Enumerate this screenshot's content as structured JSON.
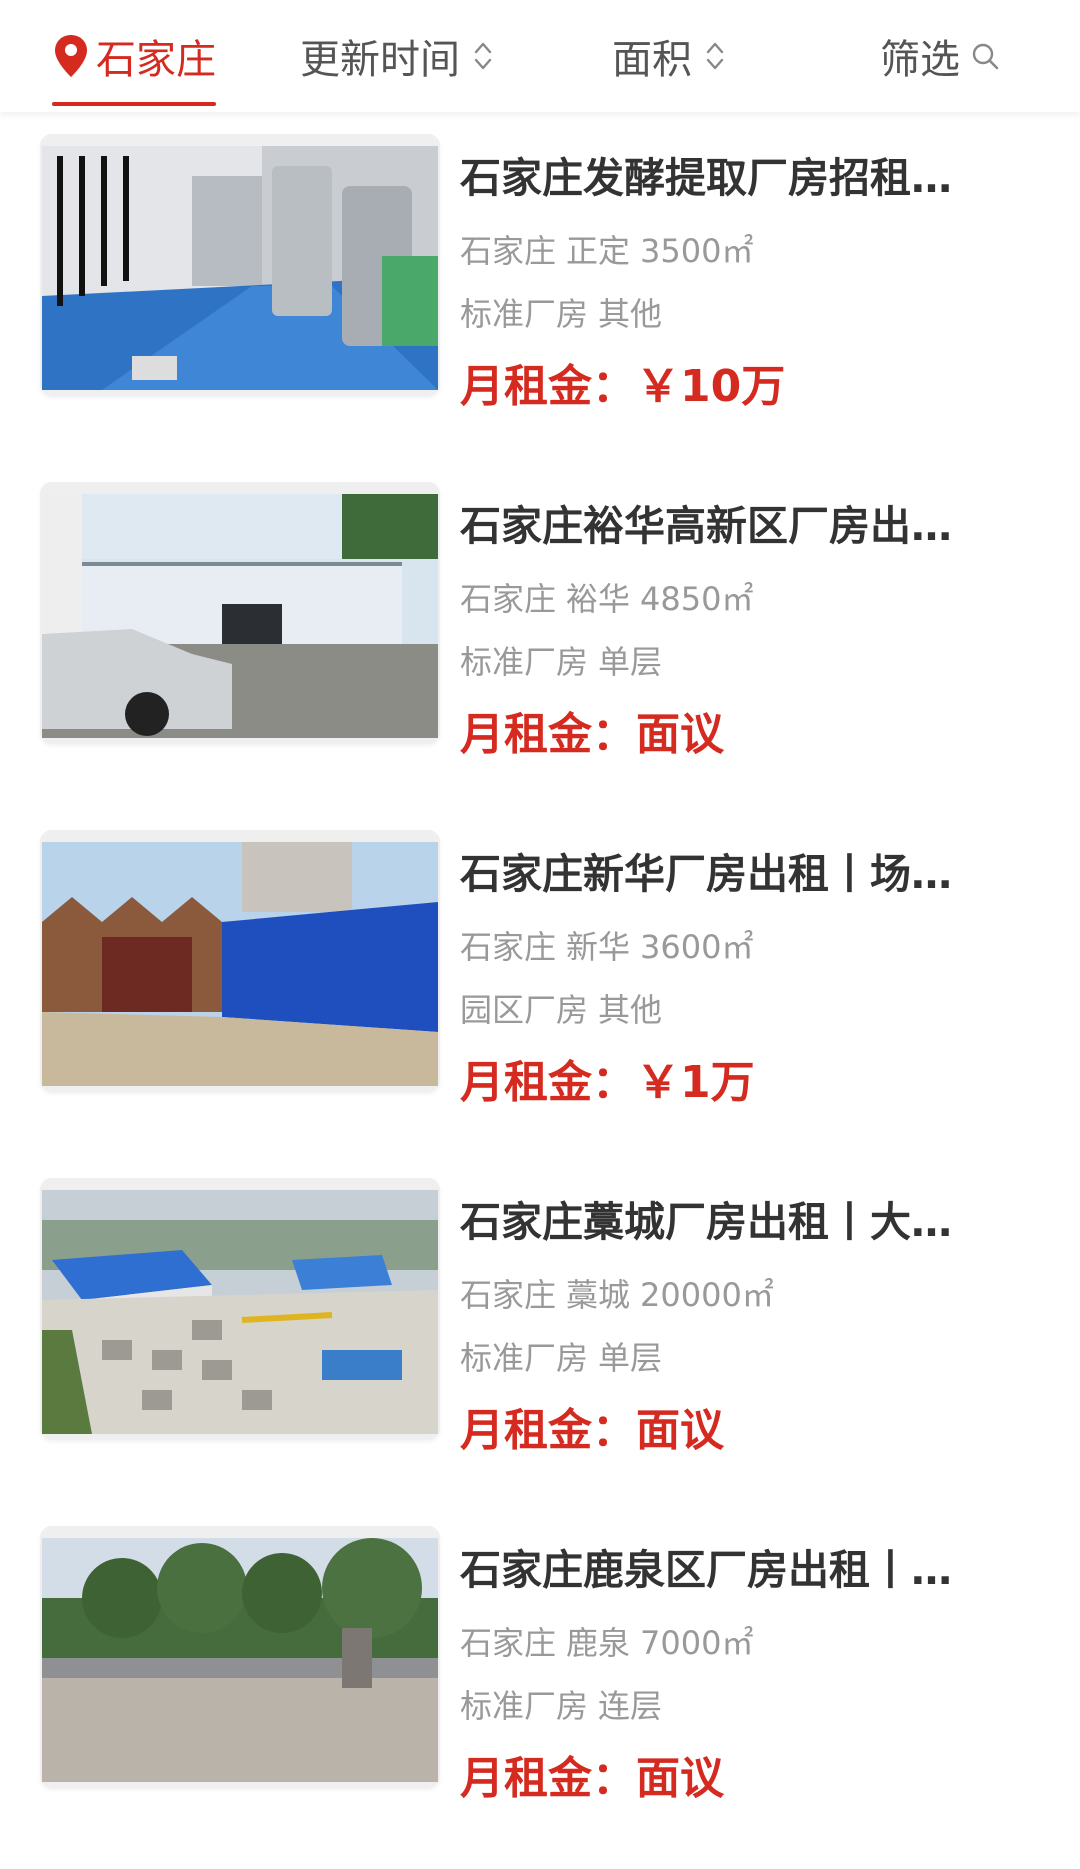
{
  "filter_bar": {
    "city": "石家庄",
    "update_time": "更新时间",
    "area": "面积",
    "screen": "筛选"
  },
  "colors": {
    "accent": "#d42a1f",
    "title": "#333333",
    "meta": "#999999"
  },
  "listings": [
    {
      "title": "石家庄发酵提取厂房招租…",
      "city": "石家庄",
      "district": "正定",
      "area": "3500㎡",
      "type": "标准厂房",
      "floor": "其他",
      "price_label": "月租金：",
      "price": "￥10万",
      "image_icon": "fermentation-workshop-photo"
    },
    {
      "title": "石家庄裕华高新区厂房出…",
      "city": "石家庄",
      "district": "裕华",
      "area": "4850㎡",
      "type": "标准厂房",
      "floor": "单层",
      "price_label": "月租金：",
      "price": "面议",
      "image_icon": "parking-yard-photo"
    },
    {
      "title": "石家庄新华厂房出租丨场…",
      "city": "石家庄",
      "district": "新华",
      "area": "3600㎡",
      "type": "园区厂房",
      "floor": "其他",
      "price_label": "月租金：",
      "price": "￥1万",
      "image_icon": "blue-warehouse-photo"
    },
    {
      "title": "石家庄藁城厂房出租丨大…",
      "city": "石家庄",
      "district": "藁城",
      "area": "20000㎡",
      "type": "标准厂房",
      "floor": "单层",
      "price_label": "月租金：",
      "price": "面议",
      "image_icon": "aerial-factory-photo"
    },
    {
      "title": "石家庄鹿泉区厂房出租丨…",
      "city": "石家庄",
      "district": "鹿泉",
      "area": "7000㎡",
      "type": "标准厂房",
      "floor": "连层",
      "price_label": "月租金：",
      "price": "面议",
      "image_icon": "tree-lined-road-photo"
    }
  ]
}
